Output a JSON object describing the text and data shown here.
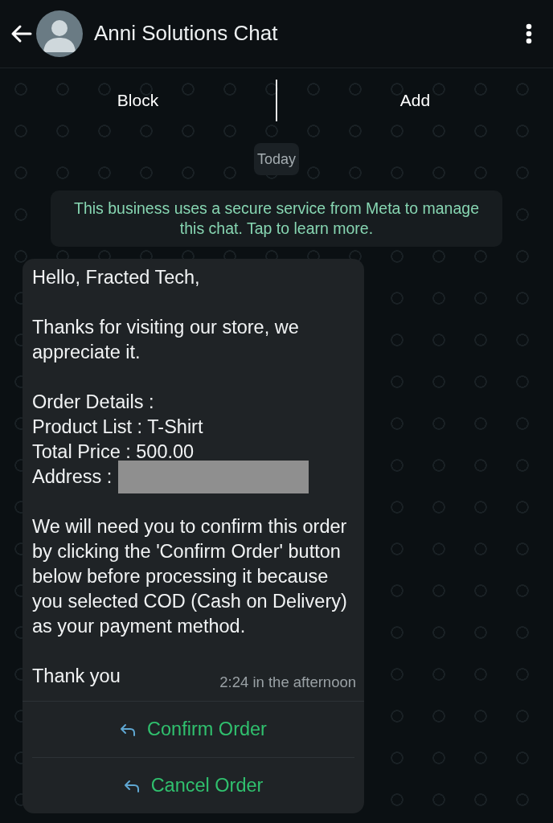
{
  "header": {
    "title": "Anni Solutions Chat"
  },
  "actions": [
    {
      "label": "Block"
    },
    {
      "label": "Add"
    }
  ],
  "date_chip": "Today",
  "info_banner": "This business uses a secure service from Meta to manage this chat. Tap to learn more.",
  "message": {
    "greeting": "Hello, Fracted Tech,",
    "intro": "Thanks for visiting our store, we appreciate it.",
    "order_details": {
      "heading": "Order Details :",
      "lines": [
        "Product List : T-Shirt",
        "Total Price : 500.00"
      ],
      "address": {
        "label": "Address :",
        "redacted": true
      }
    },
    "note": "We will need you to confirm this order by clicking the 'Confirm Order' button below before processing it because you selected COD (Cash on Delivery) as your payment method.",
    "closing": "Thank you",
    "time": "2:24 in the afternoon"
  },
  "reply_buttons": [
    {
      "label": "Confirm Order"
    },
    {
      "label": "Cancel Order"
    }
  ]
}
